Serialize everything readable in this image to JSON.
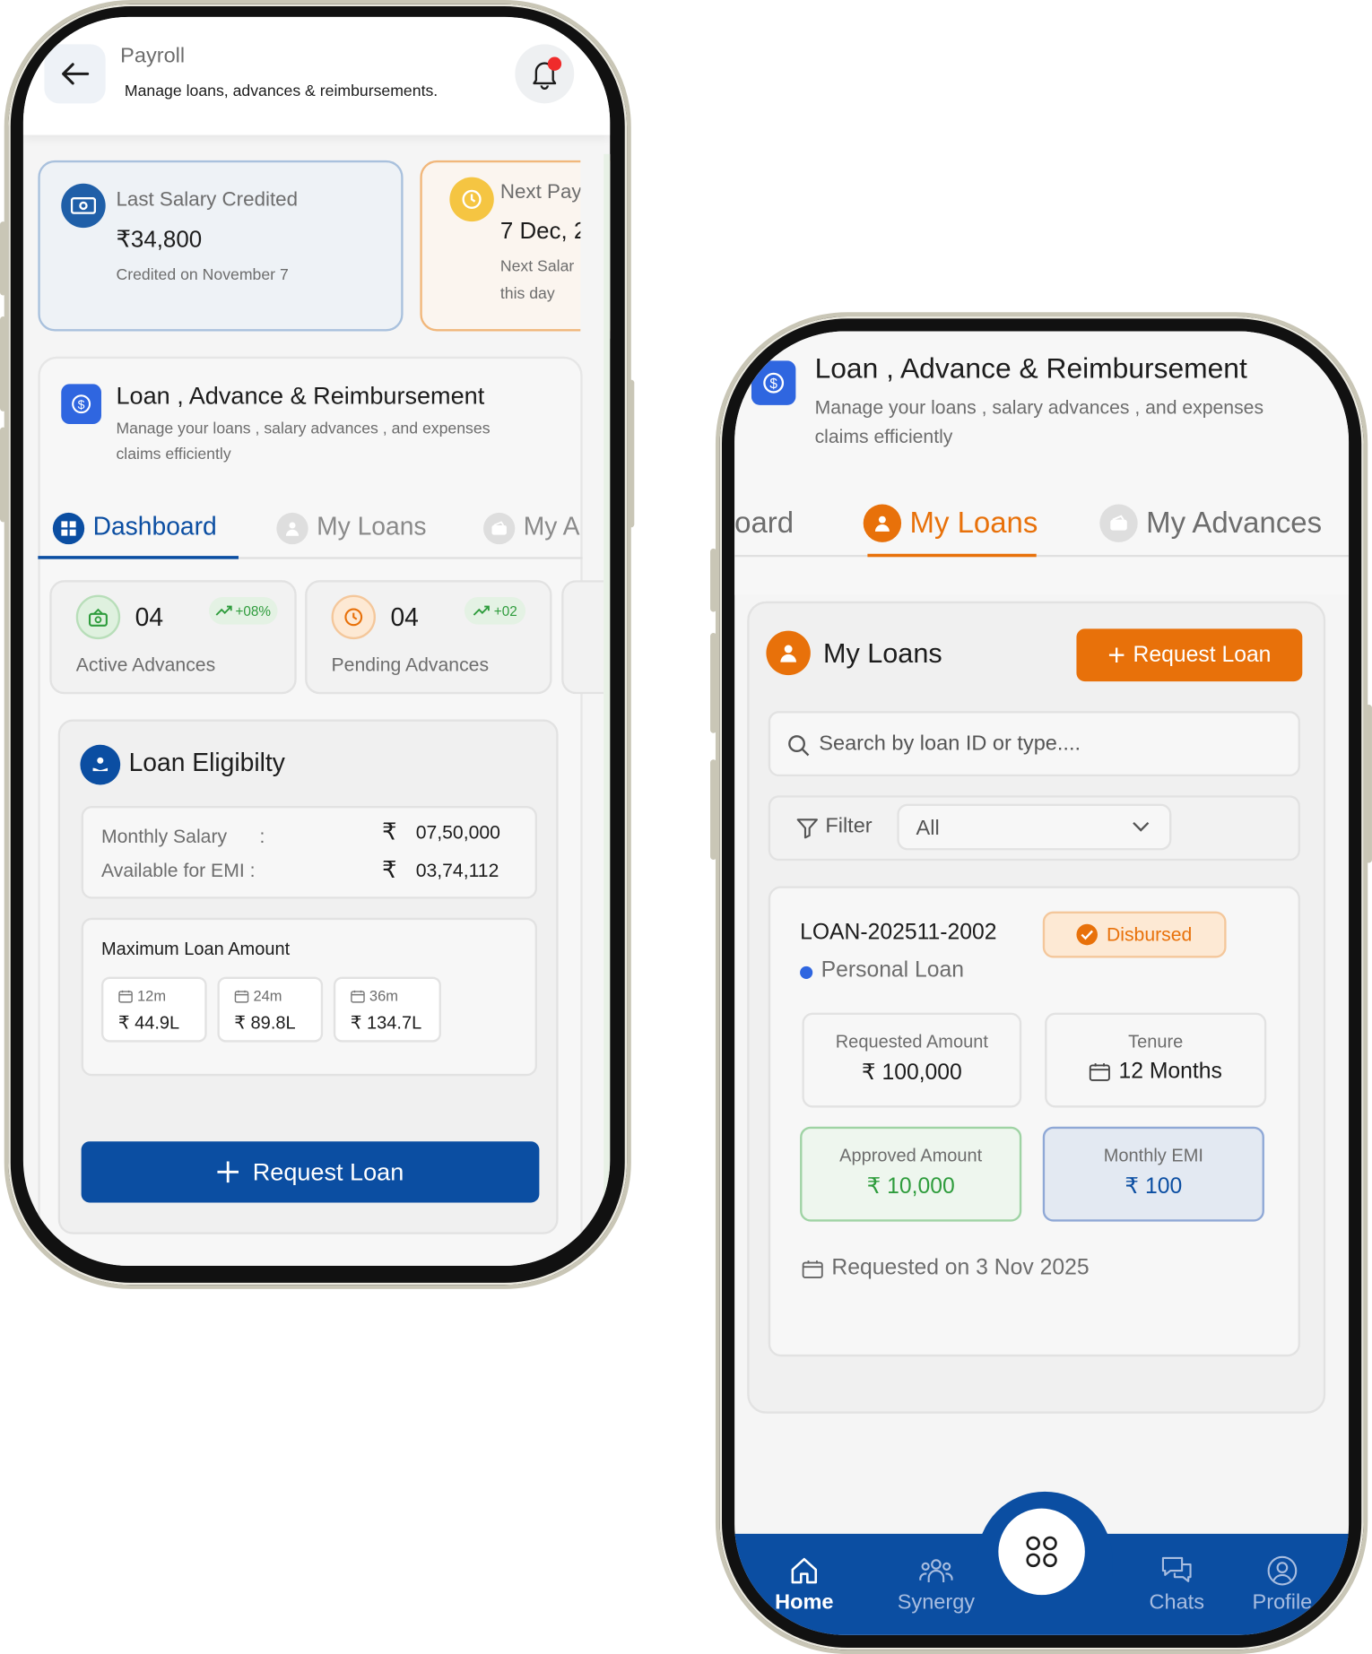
{
  "left": {
    "header": {
      "title": "Payroll",
      "subtitle": "Manage loans, advances & reimbursements."
    },
    "salary": {
      "label": "Last Salary Credited",
      "amount": "₹34,800",
      "note": "Credited on November 7"
    },
    "next_pay": {
      "label": "Next Pay",
      "date": "7 Dec, 2",
      "note1": "Next Salar",
      "note2": "this day"
    },
    "section": {
      "title": "Loan , Advance & Reimbursement",
      "desc1": "Manage your loans , salary advances , and expenses",
      "desc2": "claims efficiently"
    },
    "tabs": [
      {
        "label": "Dashboard"
      },
      {
        "label": "My Loans"
      },
      {
        "label": "My A"
      }
    ],
    "stats": [
      {
        "value": "04",
        "trend": "+08%",
        "label": "Active Advances"
      },
      {
        "value": "04",
        "trend": "+02",
        "label": "Pending Advances"
      }
    ],
    "eligibility": {
      "title": "Loan Eligibilty",
      "monthly_salary_label": "Monthly Salary",
      "sep": ":",
      "monthly_salary_value": "07,50,000",
      "emi_label": "Available for EMI :",
      "emi_value": "03,74,112",
      "rupee": "₹",
      "max_title": "Maximum Loan Amount",
      "terms": [
        {
          "term": "12m",
          "amount": "₹ 44.9L"
        },
        {
          "term": "24m",
          "amount": "₹ 89.8L"
        },
        {
          "term": "36m",
          "amount": "₹ 134.7L"
        }
      ]
    },
    "request_btn": "Request Loan"
  },
  "right": {
    "section": {
      "title": "Loan , Advance & Reimbursement",
      "desc1": "Manage your loans , salary advances , and expenses",
      "desc2": "claims efficiently"
    },
    "tabs": [
      {
        "label": "oard"
      },
      {
        "label": "My Loans"
      },
      {
        "label": "My Advances"
      }
    ],
    "my_loans": {
      "title": "My Loans",
      "request_btn": "Request Loan",
      "search_placeholder": "Search by loan ID or type....",
      "filter_label": "Filter",
      "filter_value": "All"
    },
    "loan": {
      "id": "LOAN-202511-2002",
      "status": "Disbursed",
      "type": "Personal Loan",
      "requested_label": "Requested Amount",
      "requested_value": "₹ 100,000",
      "tenure_label": "Tenure",
      "tenure_value": "12 Months",
      "approved_label": "Approved Amount",
      "approved_value": "₹ 10,000",
      "emi_label": "Monthly EMI",
      "emi_value": "₹ 100",
      "requested_on": "Requested on 3 Nov 2025"
    },
    "nav": [
      {
        "label": "Home"
      },
      {
        "label": "Synergy"
      },
      {
        "label": "Chats"
      },
      {
        "label": "Profile"
      }
    ]
  },
  "colors": {
    "primary": "#0b4ea2",
    "orange": "#e8710a",
    "green": "#2e9c3c",
    "status_bg": "#fde9d4"
  }
}
